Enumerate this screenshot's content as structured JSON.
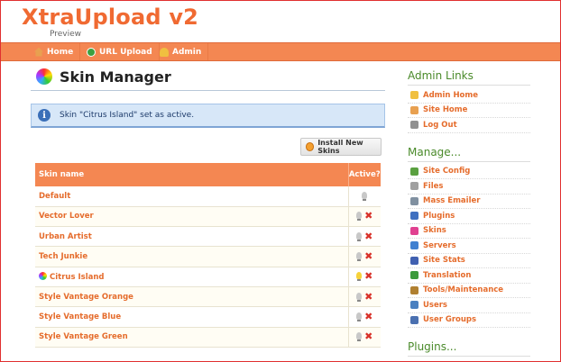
{
  "header": {
    "logo": "XtraUpload v2",
    "subtitle": "Preview"
  },
  "nav": [
    {
      "label": "Home",
      "icon": "home-icon"
    },
    {
      "label": "URL Upload",
      "icon": "url-upload-icon"
    },
    {
      "label": "Admin",
      "icon": "admin-icon"
    }
  ],
  "main": {
    "title": "Skin Manager",
    "info_message": "Skin \"Citrus Island\" set as active.",
    "install_button": "Install New Skins",
    "table": {
      "headers": [
        "Skin name",
        "Active?"
      ],
      "rows": [
        {
          "name": "Default",
          "active": false,
          "deletable": false,
          "current": false
        },
        {
          "name": "Vector Lover",
          "active": false,
          "deletable": true,
          "current": false
        },
        {
          "name": "Urban Artist",
          "active": false,
          "deletable": true,
          "current": false
        },
        {
          "name": "Tech Junkie",
          "active": false,
          "deletable": true,
          "current": false
        },
        {
          "name": "Citrus Island",
          "active": true,
          "deletable": true,
          "current": true
        },
        {
          "name": "Style Vantage Orange",
          "active": false,
          "deletable": true,
          "current": false
        },
        {
          "name": "Style Vantage Blue",
          "active": false,
          "deletable": true,
          "current": false
        },
        {
          "name": "Style Vantage Green",
          "active": false,
          "deletable": true,
          "current": false
        }
      ]
    }
  },
  "sidebar": {
    "admin_links_heading": "Admin Links",
    "admin_links": [
      {
        "label": "Admin Home",
        "icon": "admin-home-icon",
        "color": "#f0c040"
      },
      {
        "label": "Site Home",
        "icon": "site-home-icon",
        "color": "#e8a050"
      },
      {
        "label": "Log Out",
        "icon": "logout-icon",
        "color": "#909090"
      }
    ],
    "manage_heading": "Manage...",
    "manage_links": [
      {
        "label": "Site Config",
        "icon": "site-config-icon",
        "color": "#5aa040"
      },
      {
        "label": "Files",
        "icon": "files-icon",
        "color": "#a0a0a0"
      },
      {
        "label": "Mass Emailer",
        "icon": "mass-emailer-icon",
        "color": "#8090a0"
      },
      {
        "label": "Plugins",
        "icon": "plugins-icon",
        "color": "#4070c0"
      },
      {
        "label": "Skins",
        "icon": "skins-icon",
        "color": "#e04090"
      },
      {
        "label": "Servers",
        "icon": "servers-icon",
        "color": "#4080d0"
      },
      {
        "label": "Site Stats",
        "icon": "site-stats-icon",
        "color": "#4060b0"
      },
      {
        "label": "Translation",
        "icon": "translation-icon",
        "color": "#3c9a3c"
      },
      {
        "label": "Tools/Maintenance",
        "icon": "tools-icon",
        "color": "#b08030"
      },
      {
        "label": "Users",
        "icon": "users-icon",
        "color": "#4a80c0"
      },
      {
        "label": "User Groups",
        "icon": "user-groups-icon",
        "color": "#4a70b0"
      }
    ],
    "plugins_heading": "Plugins..."
  }
}
